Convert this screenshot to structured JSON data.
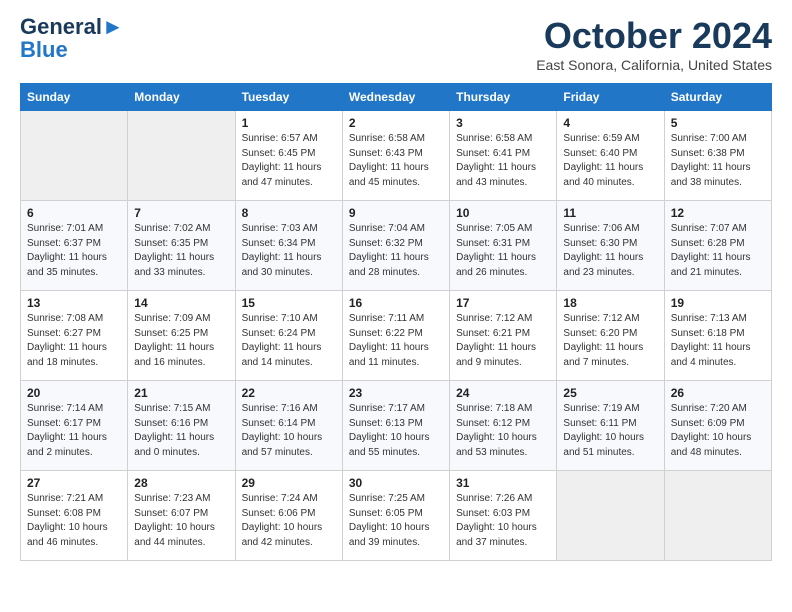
{
  "header": {
    "logo_line1": "General",
    "logo_line2": "Blue",
    "month_title": "October 2024",
    "location": "East Sonora, California, United States"
  },
  "weekdays": [
    "Sunday",
    "Monday",
    "Tuesday",
    "Wednesday",
    "Thursday",
    "Friday",
    "Saturday"
  ],
  "weeks": [
    [
      {
        "day": "",
        "info": ""
      },
      {
        "day": "",
        "info": ""
      },
      {
        "day": "1",
        "info": "Sunrise: 6:57 AM\nSunset: 6:45 PM\nDaylight: 11 hours and 47 minutes."
      },
      {
        "day": "2",
        "info": "Sunrise: 6:58 AM\nSunset: 6:43 PM\nDaylight: 11 hours and 45 minutes."
      },
      {
        "day": "3",
        "info": "Sunrise: 6:58 AM\nSunset: 6:41 PM\nDaylight: 11 hours and 43 minutes."
      },
      {
        "day": "4",
        "info": "Sunrise: 6:59 AM\nSunset: 6:40 PM\nDaylight: 11 hours and 40 minutes."
      },
      {
        "day": "5",
        "info": "Sunrise: 7:00 AM\nSunset: 6:38 PM\nDaylight: 11 hours and 38 minutes."
      }
    ],
    [
      {
        "day": "6",
        "info": "Sunrise: 7:01 AM\nSunset: 6:37 PM\nDaylight: 11 hours and 35 minutes."
      },
      {
        "day": "7",
        "info": "Sunrise: 7:02 AM\nSunset: 6:35 PM\nDaylight: 11 hours and 33 minutes."
      },
      {
        "day": "8",
        "info": "Sunrise: 7:03 AM\nSunset: 6:34 PM\nDaylight: 11 hours and 30 minutes."
      },
      {
        "day": "9",
        "info": "Sunrise: 7:04 AM\nSunset: 6:32 PM\nDaylight: 11 hours and 28 minutes."
      },
      {
        "day": "10",
        "info": "Sunrise: 7:05 AM\nSunset: 6:31 PM\nDaylight: 11 hours and 26 minutes."
      },
      {
        "day": "11",
        "info": "Sunrise: 7:06 AM\nSunset: 6:30 PM\nDaylight: 11 hours and 23 minutes."
      },
      {
        "day": "12",
        "info": "Sunrise: 7:07 AM\nSunset: 6:28 PM\nDaylight: 11 hours and 21 minutes."
      }
    ],
    [
      {
        "day": "13",
        "info": "Sunrise: 7:08 AM\nSunset: 6:27 PM\nDaylight: 11 hours and 18 minutes."
      },
      {
        "day": "14",
        "info": "Sunrise: 7:09 AM\nSunset: 6:25 PM\nDaylight: 11 hours and 16 minutes."
      },
      {
        "day": "15",
        "info": "Sunrise: 7:10 AM\nSunset: 6:24 PM\nDaylight: 11 hours and 14 minutes."
      },
      {
        "day": "16",
        "info": "Sunrise: 7:11 AM\nSunset: 6:22 PM\nDaylight: 11 hours and 11 minutes."
      },
      {
        "day": "17",
        "info": "Sunrise: 7:12 AM\nSunset: 6:21 PM\nDaylight: 11 hours and 9 minutes."
      },
      {
        "day": "18",
        "info": "Sunrise: 7:12 AM\nSunset: 6:20 PM\nDaylight: 11 hours and 7 minutes."
      },
      {
        "day": "19",
        "info": "Sunrise: 7:13 AM\nSunset: 6:18 PM\nDaylight: 11 hours and 4 minutes."
      }
    ],
    [
      {
        "day": "20",
        "info": "Sunrise: 7:14 AM\nSunset: 6:17 PM\nDaylight: 11 hours and 2 minutes."
      },
      {
        "day": "21",
        "info": "Sunrise: 7:15 AM\nSunset: 6:16 PM\nDaylight: 11 hours and 0 minutes."
      },
      {
        "day": "22",
        "info": "Sunrise: 7:16 AM\nSunset: 6:14 PM\nDaylight: 10 hours and 57 minutes."
      },
      {
        "day": "23",
        "info": "Sunrise: 7:17 AM\nSunset: 6:13 PM\nDaylight: 10 hours and 55 minutes."
      },
      {
        "day": "24",
        "info": "Sunrise: 7:18 AM\nSunset: 6:12 PM\nDaylight: 10 hours and 53 minutes."
      },
      {
        "day": "25",
        "info": "Sunrise: 7:19 AM\nSunset: 6:11 PM\nDaylight: 10 hours and 51 minutes."
      },
      {
        "day": "26",
        "info": "Sunrise: 7:20 AM\nSunset: 6:09 PM\nDaylight: 10 hours and 48 minutes."
      }
    ],
    [
      {
        "day": "27",
        "info": "Sunrise: 7:21 AM\nSunset: 6:08 PM\nDaylight: 10 hours and 46 minutes."
      },
      {
        "day": "28",
        "info": "Sunrise: 7:23 AM\nSunset: 6:07 PM\nDaylight: 10 hours and 44 minutes."
      },
      {
        "day": "29",
        "info": "Sunrise: 7:24 AM\nSunset: 6:06 PM\nDaylight: 10 hours and 42 minutes."
      },
      {
        "day": "30",
        "info": "Sunrise: 7:25 AM\nSunset: 6:05 PM\nDaylight: 10 hours and 39 minutes."
      },
      {
        "day": "31",
        "info": "Sunrise: 7:26 AM\nSunset: 6:03 PM\nDaylight: 10 hours and 37 minutes."
      },
      {
        "day": "",
        "info": ""
      },
      {
        "day": "",
        "info": ""
      }
    ]
  ]
}
